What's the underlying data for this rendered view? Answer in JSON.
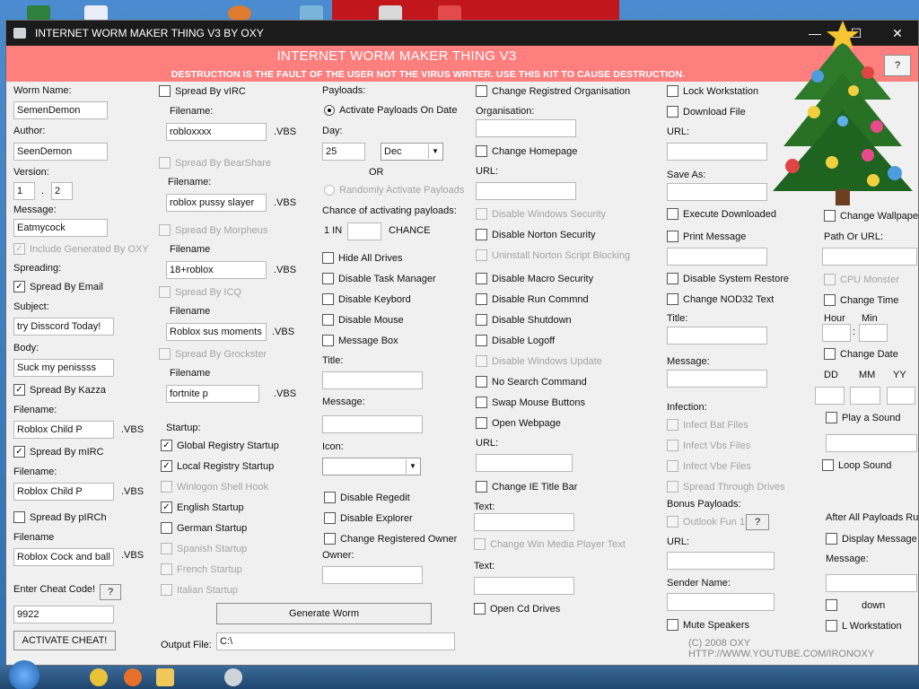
{
  "window": {
    "title": "INTERNET WORM MAKER THING V3  BY OXY"
  },
  "banner": {
    "heading": "INTERNET WORM MAKER THING V3",
    "warning": "DESTRUCTION IS THE FAULT OF THE USER NOT THE VIRUS WRITER. USE THIS KIT TO CAUSE DESTRUCTION.",
    "help_label": "?"
  },
  "col1": {
    "worm_name_label": "Worm Name:",
    "worm_name": "SemenDemon",
    "author_label": "Author:",
    "author": "SeenDemon",
    "version_label": "Version:",
    "version_major": "1",
    "version_dot": ".",
    "version_minor": "2",
    "message_label": "Message:",
    "message": "Eatmycock",
    "include_generated": "Include Generated By OXY",
    "spreading_label": "Spreading:",
    "spread_email": "Spread By Email",
    "subject_label": "Subject:",
    "subject": "try Disscord Today!",
    "body_label": "Body:",
    "body": "Suck my penissss",
    "spread_kazza": "Spread By Kazza",
    "kazza_filename_label": "Filename:",
    "kazza_filename": "Roblox Child P",
    "kazza_ext": ".VBS",
    "spread_mirc": "Spread By mIRC",
    "mirc_filename_label": "Filename:",
    "mirc_filename": "Roblox Child P",
    "mirc_ext": ".VBS",
    "spread_pirch": "Spread By pIRCh",
    "pirch_filename_label": "Filename",
    "pirch_filename": "Roblox Cock and ball",
    "pirch_ext": ".VBS",
    "cheat_label": "Enter Cheat Code!",
    "cheat_help": "?",
    "cheat_code": "9922",
    "activate_cheat": "ACTIVATE CHEAT!"
  },
  "col2": {
    "spread_virc": "Spread By vIRC",
    "virc_filename_label": "Filename:",
    "virc_filename": "robloxxxx",
    "virc_ext": ".VBS",
    "spread_bearshare": "Spread By BearShare",
    "bearshare_filename_label": "Filename:",
    "bearshare_filename": "roblox pussy slayer",
    "bearshare_ext": ".VBS",
    "spread_morpheus": "Spread By Morpheus",
    "morpheus_filename_label": "Filename",
    "morpheus_filename": "18+roblox",
    "morpheus_ext": ".VBS",
    "spread_icq": "Spread By ICQ",
    "icq_filename_label": "Filename",
    "icq_filename": "Roblox sus moments",
    "icq_ext": ".VBS",
    "spread_grokster": "Spread By Grockster",
    "grokster_filename_label": "Filename",
    "grokster_filename": "fortnite p",
    "grokster_ext": ".VBS",
    "startup_label": "Startup:",
    "global_registry": "Global Registry Startup",
    "local_registry": "Local Registry Startup",
    "winlogon": "Winlogon Shell Hook",
    "english": "English Startup",
    "german": "German Startup",
    "spanish": "Spanish Startup",
    "french": "French Startup",
    "italian": "Italian Startup",
    "generate": "Generate Worm",
    "output_label": "Output File:",
    "output_value": "C:\\"
  },
  "col3": {
    "payloads_label": "Payloads:",
    "activate_on_date": "Activate Payloads On Date",
    "day_label": "Day:",
    "day_value": "25",
    "month_value": "Dec",
    "or_label": "OR",
    "randomly": "Randomly Activate Payloads",
    "chance_label": "Chance of activating payloads:",
    "one_in": "1 IN",
    "chance_word": "CHANCE",
    "hide_drives": "Hide All Drives",
    "disable_taskmgr": "Disable Task Manager",
    "disable_keyboard": "Disable Keybord",
    "disable_mouse": "Disable Mouse",
    "message_box": "Message Box",
    "title_label": "Title:",
    "message_label": "Message:",
    "icon_label": "Icon:",
    "disable_regedit": "Disable Regedit",
    "disable_explorer": "Disable Explorer",
    "change_owner": "Change Registered Owner",
    "owner_label": "Owner:"
  },
  "col4": {
    "change_org": "Change Registred Organisation",
    "org_label": "Organisation:",
    "change_homepage": "Change Homepage",
    "url_label": "URL:",
    "disable_win_security": "Disable Windows Security",
    "disable_norton": "Disable Norton Security",
    "uninstall_norton": "Uninstall Norton Script Blocking",
    "disable_macro": "Disable Macro Security",
    "disable_run": "Disable Run Commnd",
    "disable_shutdown": "Disable Shutdown",
    "disable_logoff": "Disable Logoff",
    "disable_win_update": "Disable Windows Update",
    "no_search": "No Search Command",
    "swap_mouse": "Swap Mouse Buttons",
    "open_webpage": "Open Webpage",
    "url2_label": "URL:",
    "change_ie_title": "Change IE Title Bar",
    "text_label": "Text:",
    "change_wmp": "Change Win Media Player Text",
    "text2_label": "Text:",
    "open_cd": "Open Cd Drives"
  },
  "col5": {
    "lock_ws": "Lock Workstation",
    "download_file": "Download File",
    "url_label": "URL:",
    "save_as_label": "Save As:",
    "exec_downloaded": "Execute Downloaded",
    "print_message": "Print Message",
    "disable_restore": "Disable System Restore",
    "change_nod32": "Change NOD32 Text",
    "title_label": "Title:",
    "message_label": "Message:",
    "infection_label": "Infection:",
    "infect_bat": "Infect Bat Files",
    "infect_vbs": "Infect Vbs Files",
    "infect_vbe": "Infect Vbe Files",
    "spread_drives": "Spread Through Drives",
    "bonus_label": "Bonus Payloads:",
    "outlook_fun": "Outlook Fun 1",
    "outlook_help": "?",
    "url2_label": "URL:",
    "sender_label": "Sender Name:",
    "mute_speakers": "Mute Speakers"
  },
  "col6": {
    "change_wallpaper": "Change Wallpaper",
    "path_label": "Path Or URL:",
    "cpu_monster": "CPU Monster",
    "change_time": "Change Time",
    "hour_label": "Hour",
    "min_label": "Min",
    "time_sep": ":",
    "change_date": "Change Date",
    "dd_label": "DD",
    "mm_label": "MM",
    "yy_label": "YY",
    "play_sound": "Play a Sound",
    "loop_sound": "Loop Sound",
    "after_all": "After All Payloads Run",
    "display_message": "Display Message",
    "message_label": "Message:",
    "shutdown": "down",
    "lock_ws": "L  Workstation"
  },
  "footer": {
    "copyright": "(C) 2008 OXY HTTP://WWW.YOUTUBE.COM/IRONOXY"
  },
  "colors": {
    "banner": "#ff7f7f",
    "titlebar": "#1b1b1b",
    "window": "#f0f0f0"
  }
}
